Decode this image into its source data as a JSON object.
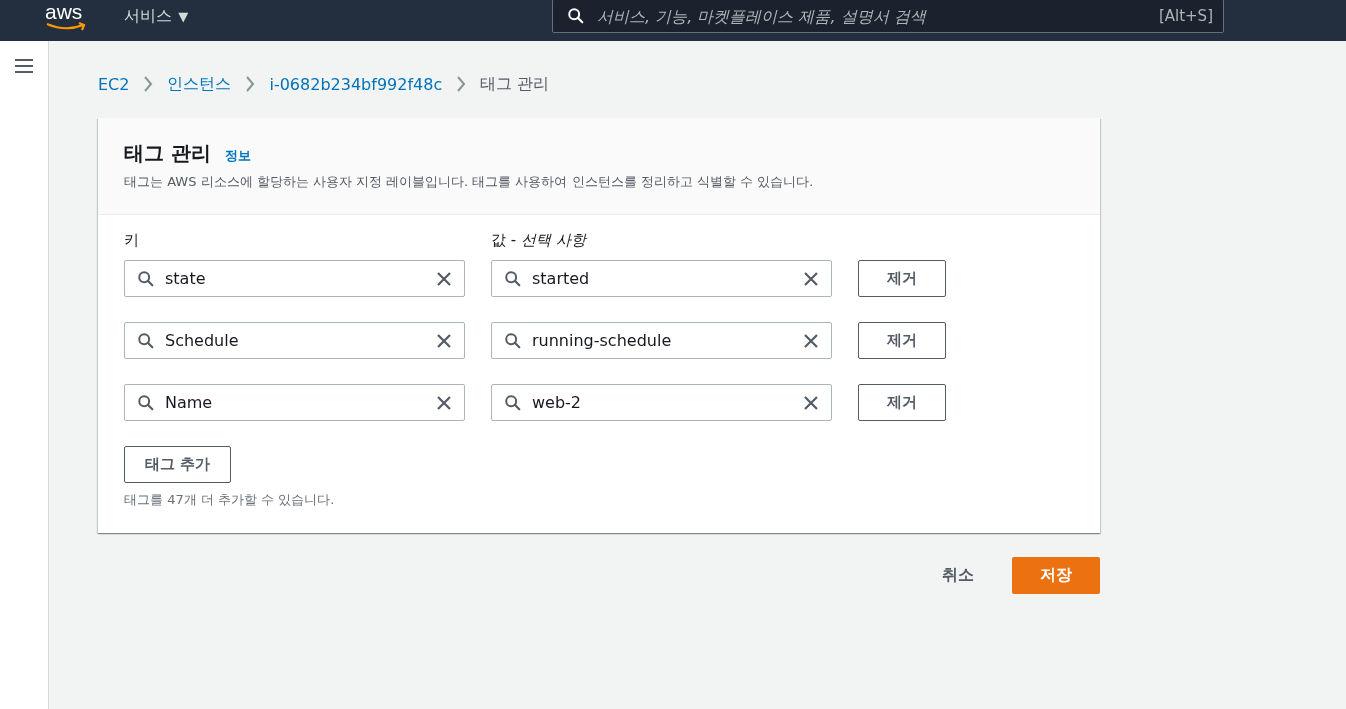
{
  "top_bar": {
    "logo": "aws",
    "services_menu": "서비스",
    "services_caret": "▼",
    "search": {
      "placeholder": "서비스, 기능, 마켓플레이스 제품, 설명서 검색",
      "shortcut": "[Alt+S]"
    }
  },
  "breadcrumbs": [
    {
      "label": "EC2",
      "link": true
    },
    {
      "label": "인스턴스",
      "link": true
    },
    {
      "label": "i-0682b234bf992f48c",
      "link": true
    },
    {
      "label": "태그 관리",
      "link": false
    }
  ],
  "panel": {
    "title": "태그 관리",
    "info_link": "정보",
    "description": "태그는 AWS 리소스에 할당하는 사용자 지정 레이블입니다. 태그를 사용하여 인스턴스를 정리하고 식별할 수 있습니다.",
    "key_label": "키",
    "value_label": "값 - *선택 사항*",
    "tags": [
      {
        "key": "state",
        "value": "started",
        "remove": "제거"
      },
      {
        "key": "Schedule",
        "value": "running-schedule",
        "remove": "제거"
      },
      {
        "key": "Name",
        "value": "web-2",
        "remove": "제거"
      }
    ],
    "add_button": "태그 추가",
    "limit_note": "태그를 47개 더 추가할 수 있습니다."
  },
  "actions": {
    "cancel": "취소",
    "save": "저장"
  }
}
